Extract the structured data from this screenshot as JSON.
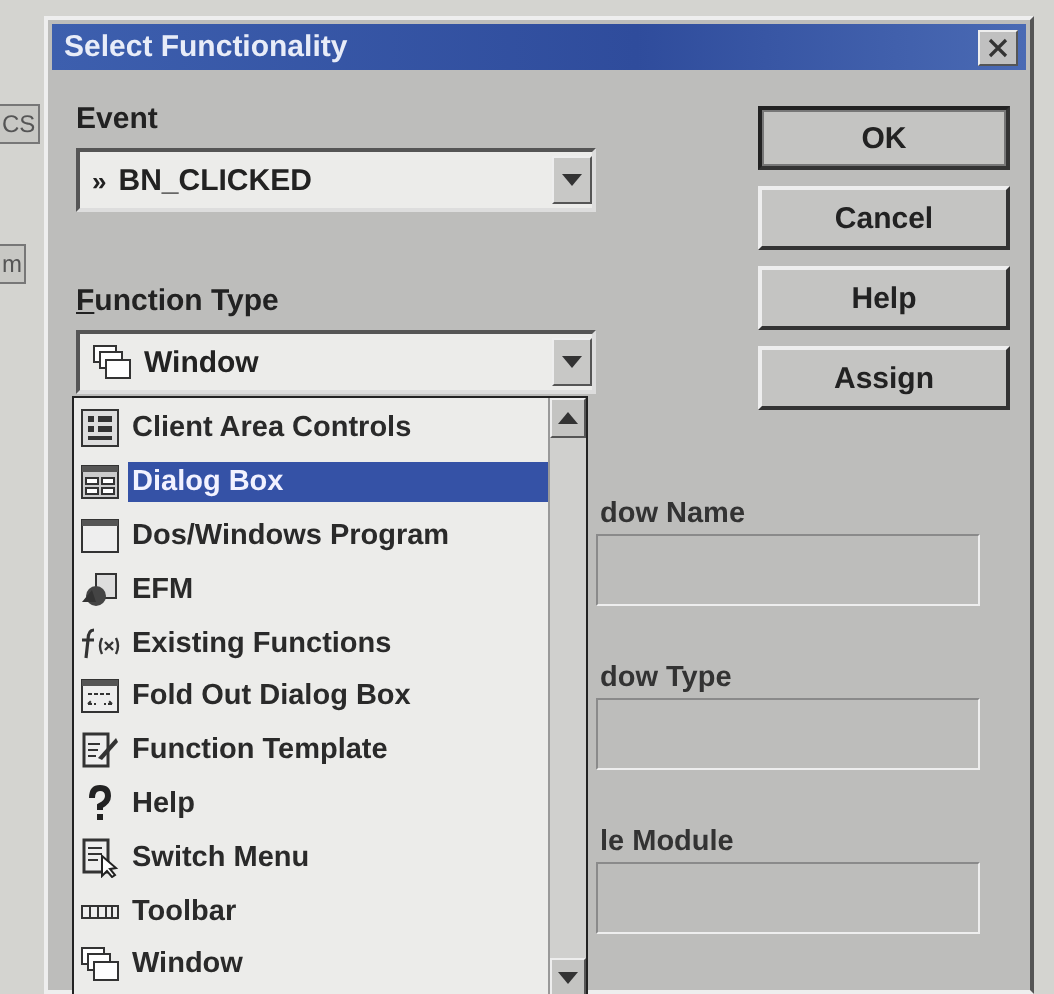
{
  "background": {
    "fragments": [
      "CS",
      "m"
    ]
  },
  "window": {
    "title": "Select Functionality"
  },
  "event": {
    "label": "Event",
    "value": "BN_CLICKED",
    "marker": "»"
  },
  "function_type": {
    "label": "Function Type",
    "value": "Window"
  },
  "buttons": [
    {
      "label": "OK",
      "default": true
    },
    {
      "label": "Cancel",
      "default": false
    },
    {
      "label": "Help",
      "default": false
    },
    {
      "label": "Assign",
      "default": false
    }
  ],
  "dropdown": {
    "items": [
      {
        "label": "Client Area Controls",
        "selected": false
      },
      {
        "label": "Dialog Box",
        "selected": true
      },
      {
        "label": "Dos/Windows Program",
        "selected": false
      },
      {
        "label": "EFM",
        "selected": false
      },
      {
        "label": "Existing Functions",
        "selected": false
      },
      {
        "label": "Fold Out Dialog Box",
        "selected": false
      },
      {
        "label": "Function Template",
        "selected": false
      },
      {
        "label": "Help",
        "selected": false
      },
      {
        "label": "Switch Menu",
        "selected": false
      },
      {
        "label": "Toolbar",
        "selected": false
      },
      {
        "label": "Window",
        "selected": false
      }
    ]
  },
  "fields": [
    {
      "label": "dow Name"
    },
    {
      "label": "dow Type"
    },
    {
      "label": "le Module"
    }
  ]
}
